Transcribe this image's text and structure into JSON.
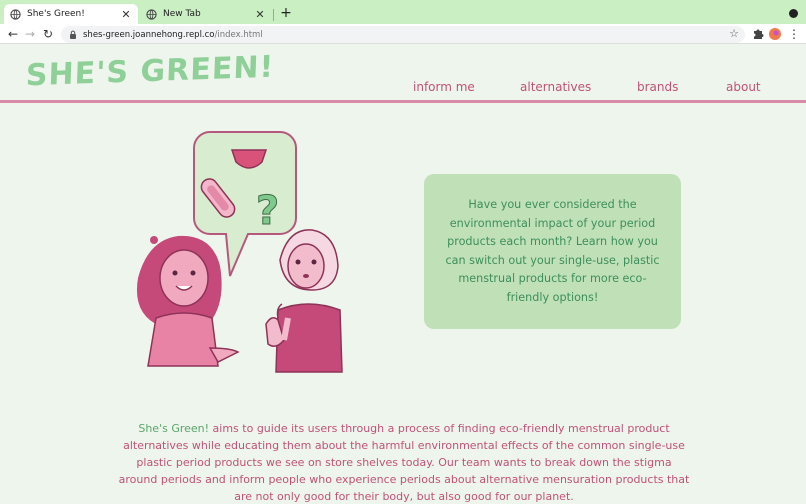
{
  "browser": {
    "tabs": [
      {
        "title": "She's Green!",
        "active": true
      },
      {
        "title": "New Tab",
        "active": false
      }
    ],
    "url_host": "shes-green.joannehong.repl.co",
    "url_path": "/index.html"
  },
  "site": {
    "logo": "SHE'S GREEN!",
    "nav": [
      "inform me",
      "alternatives",
      "brands",
      "about"
    ]
  },
  "hero": {
    "card_text": "Have you ever considered the environmental impact of your period products each month? Learn how you can switch out your single-use, plastic menstrual products for more eco-friendly options!"
  },
  "blurb": {
    "brand": "She's Green!",
    "text": " aims to guide its users through a process of finding eco-friendly menstrual product alternatives while educating them about the harmful environmental effects of the common single-use plastic period products we see on store shelves today. Our team wants to break down the stigma around periods and inform people who experience periods about alternative mensuration products that are not only good for their body, but also good for our planet."
  },
  "colors": {
    "chrome_tabstrip": "#c9efc3",
    "page_bg": "#eef5ec",
    "logo_green": "#8fcf98",
    "accent_pink": "#c0527a",
    "card_bg": "#c0e0b8",
    "card_text": "#3d8f5b"
  }
}
